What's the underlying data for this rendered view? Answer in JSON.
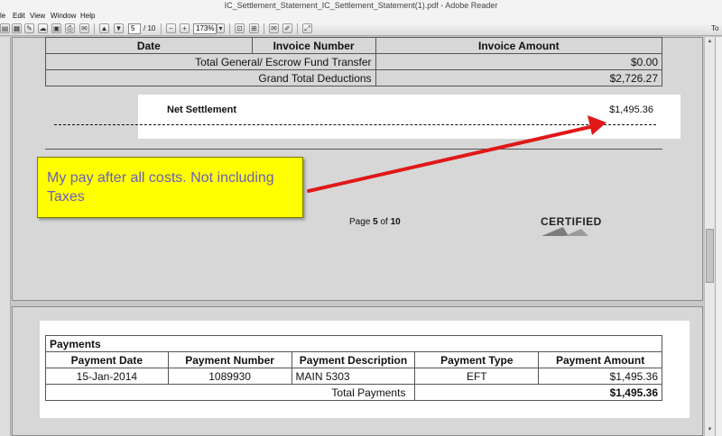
{
  "window": {
    "title": "IC_Settlement_Statement_IC_Settlement_Statement(1).pdf - Adobe Reader"
  },
  "menu": {
    "items": [
      "le",
      "Edit",
      "View",
      "Window",
      "Help"
    ]
  },
  "toolbar": {
    "page_current": "5",
    "page_total": "/ 10",
    "zoom": "173%",
    "right_label": "To"
  },
  "invoice_table": {
    "headers": [
      "Date",
      "Invoice Number",
      "Invoice Amount"
    ],
    "rows": [
      {
        "label": "Total General/ Escrow Fund Transfer",
        "amount": "$0.00"
      },
      {
        "label": "Grand Total Deductions",
        "amount": "$2,726.27"
      }
    ]
  },
  "net_settlement": {
    "label": "Net Settlement",
    "amount": "$1,495.36"
  },
  "annotation": {
    "text": "My pay after all costs. Not including Taxes",
    "color": "#ffff00",
    "arrow_color": "#e01818"
  },
  "footer": {
    "page_prefix": "Page ",
    "page_num": "5",
    "page_of": " of ",
    "page_total": "10",
    "certified": "CERTIFIED"
  },
  "payments": {
    "title": "Payments",
    "headers": [
      "Payment  Date",
      "Payment  Number",
      "Payment Description",
      "Payment Type",
      "Payment Amount"
    ],
    "rows": [
      {
        "date": "15-Jan-2014",
        "number": "1089930",
        "description": "MAIN 5303",
        "type": "EFT",
        "amount": "$1,495.36"
      }
    ],
    "total_label": "Total Payments",
    "total_amount": "$1,495.36"
  }
}
